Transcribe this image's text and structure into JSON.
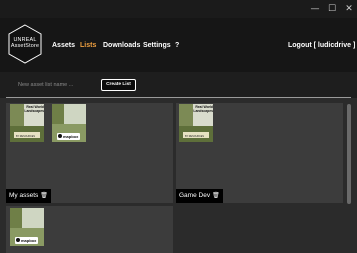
{
  "window": {
    "minimize_icon": "minimize-icon",
    "maximize_icon": "maximize-icon",
    "close_icon": "close-icon",
    "minimize_glyph": "—",
    "maximize_glyph": "☐",
    "close_glyph": "✕"
  },
  "logo": {
    "line1": "UNREAL",
    "line2": "AssetStore"
  },
  "nav": {
    "assets": "Assets",
    "lists": "Lists",
    "downloads": "Downloads",
    "settings": "Settings",
    "help": "?",
    "active_color": "#f0a040"
  },
  "logout": "Logout [ ludicdrive ]",
  "create": {
    "placeholder": "New asset list name ...",
    "button": "Create List"
  },
  "thumbnails": {
    "landscapes_title": "Real World Landscapes",
    "publisher": "BY RESOURCES",
    "mapbox": "mapbox"
  },
  "lists": [
    {
      "name": "My assets",
      "items": [
        "Real World Landscapes",
        "mapbox"
      ]
    },
    {
      "name": "Game Dev",
      "items": [
        "Real World Landscapes"
      ]
    },
    {
      "name": "",
      "items": [
        "mapbox"
      ]
    }
  ],
  "trash_glyph": "🗑"
}
